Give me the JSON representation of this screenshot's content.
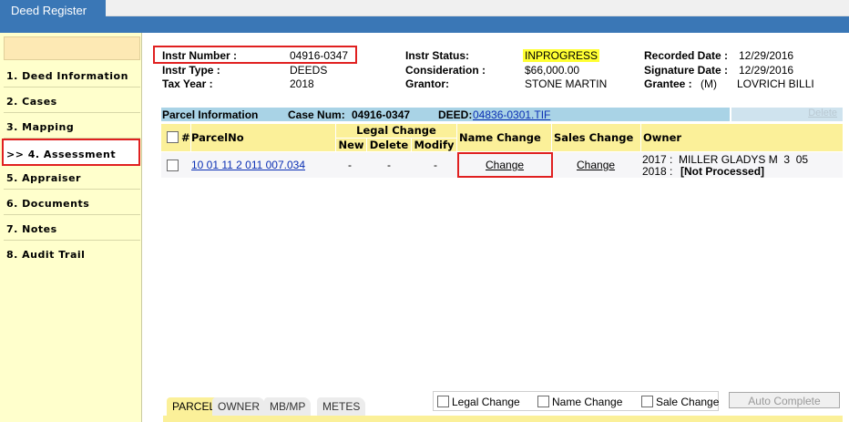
{
  "app": {
    "tab_title": "Deed Register"
  },
  "sidebar": {
    "items": [
      {
        "label": "1. Deed Information",
        "active": false
      },
      {
        "label": "2. Cases",
        "active": false
      },
      {
        "label": "3. Mapping",
        "active": false
      },
      {
        "label": ">> 4. Assessment",
        "active": true
      },
      {
        "label": "5. Appraiser",
        "active": false
      },
      {
        "label": "6. Documents",
        "active": false
      },
      {
        "label": "7. Notes",
        "active": false
      },
      {
        "label": "8. Audit Trail",
        "active": false
      }
    ]
  },
  "header": {
    "instr_number_label": "Instr Number :",
    "instr_number_value": "04916-0347",
    "instr_type_label": "Instr Type :",
    "instr_type_value": "DEEDS",
    "tax_year_label": "Tax Year :",
    "tax_year_value": "2018",
    "instr_status_label": "Instr Status:",
    "instr_status_value": "INPROGRESS",
    "consideration_label": "Consideration :",
    "consideration_value": "$66,000.00",
    "grantor_label": "Grantor:",
    "grantor_value": "STONE MARTIN",
    "recorded_date_label": "Recorded Date :",
    "recorded_date_value": "12/29/2016",
    "signature_date_label": "Signature Date :",
    "signature_date_value": "12/29/2016",
    "grantee_label": "Grantee :",
    "grantee_type": "(M)",
    "grantee_value": "LOVRICH BILLI"
  },
  "parcel_info": {
    "title": "Parcel Information",
    "case_num_label": "Case Num:",
    "case_num_value": "04916-0347",
    "deed_label": "DEED:",
    "deed_link": " 04836-0301.TIF",
    "delete_label": "Delete"
  },
  "table": {
    "headers": {
      "num": "#",
      "parcel_no": "ParcelNo",
      "legal_change": "Legal Change",
      "new": "New",
      "delete": "Delete",
      "modify": "Modify",
      "name_change": "Name Change",
      "sales_change": "Sales Change",
      "owner": "Owner"
    },
    "rows": [
      {
        "parcel_no": "10 01 11 2 011 007.034",
        "new": "-",
        "delete": "-",
        "modify": "-",
        "name_change": "Change",
        "sales_change": "Change",
        "owner_line1": "2017 :  MILLER GLADYS M  3  05",
        "owner_line2_prefix": "2018 : ",
        "owner_line2_bold": "[Not Processed]"
      }
    ]
  },
  "bottom": {
    "tabs": [
      "PARCEL",
      "OWNER",
      "MB/MP",
      "METES"
    ],
    "options": [
      "Legal Change",
      "Name Change",
      "Sale Change"
    ],
    "auto_complete": "Auto Complete"
  },
  "colors": {
    "accent_blue": "#3a77b6",
    "sidebar_bg": "#ffffcc",
    "header_yellow": "#fbf099",
    "parcel_bar": "#a9d3e6",
    "highlight_red": "#e02020",
    "status_yellow": "#ffff33"
  }
}
